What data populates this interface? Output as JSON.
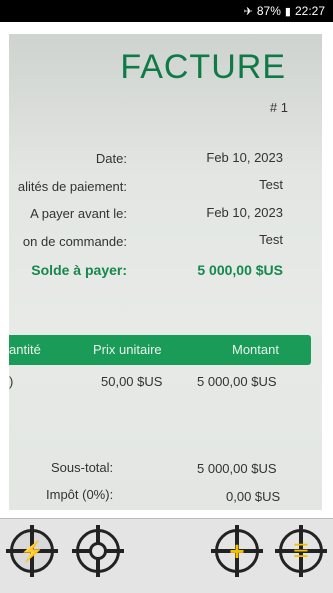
{
  "statusbar": {
    "airplane_icon": "airplane-icon",
    "battery": "87%",
    "time": "22:27"
  },
  "invoice": {
    "title": "FACTURE",
    "number": "# 1",
    "fields": [
      {
        "label": "Date:",
        "value": "Feb 10, 2023"
      },
      {
        "label": "alités de paiement:",
        "value": "Test"
      },
      {
        "label": "A payer avant le:",
        "value": "Feb 10, 2023"
      },
      {
        "label": "on de commande:",
        "value": "Test"
      }
    ],
    "balance": {
      "label": "Solde à payer:",
      "value": "5 000,00 $US"
    },
    "table": {
      "headers": [
        "antité",
        "Prix unitaire",
        "Montant"
      ],
      "row": {
        "qty": ")",
        "unit_price": "50,00 $US",
        "amount": "5 000,00 $US"
      }
    },
    "subtotal": {
      "label": "Sous-total:",
      "value": "5 000,00 $US"
    },
    "tax": {
      "label": "Impôt (0%):",
      "value": "0,00 $US"
    }
  },
  "toolbar": {
    "flash_icon": "flash-icon",
    "capture_icon": "capture-icon",
    "add_icon": "add-icon",
    "list_icon": "list-icon"
  }
}
